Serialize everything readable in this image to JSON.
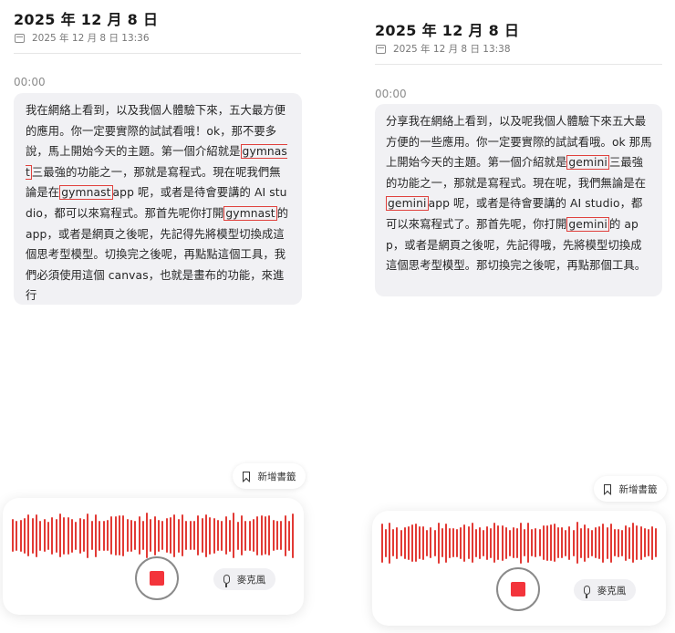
{
  "left": {
    "title": "2025 年 12 月 8 日",
    "datetime": "2025 年 12 月 8 日 13:36",
    "timestamp": "00:00",
    "segments": [
      {
        "t": "我在網絡上看到，以及我個人體驗下來，五大最方便的應用。你一定要實際的試試看哦！ok，那不要多說，馬上開始今天的主題。第一個介紹就是"
      },
      {
        "t": "gymnast",
        "hl": true
      },
      {
        "t": "三最強的功能之一，那就是寫程式。現在呢我們無論是在"
      },
      {
        "t": "gymnast",
        "hl": true
      },
      {
        "t": "app 呢，或者是待會要講的 AI studio，都可以來寫程式。那首先呢你打開"
      },
      {
        "t": "gymnast",
        "hl": true
      },
      {
        "t": "的 app，或者是網頁之後呢，先記得先將模型切換成這個思考型模型。切換完之後呢，再點點這個工具，我們必須使用這個 canvas，也就是畫布的功能，來進行"
      }
    ],
    "bookmark_label": "新增書籤",
    "mic_label": "麥克風"
  },
  "right": {
    "title": "2025 年 12 月 8 日",
    "datetime": "2025 年 12 月 8 日 13:38",
    "timestamp": "00:00",
    "segments": [
      {
        "t": "分享我在網絡上看到，以及呢我個人體驗下來五大最方便的一些應用。你一定要實際的試試看哦。ok 那馬上開始今天的主題。第一個介紹就是"
      },
      {
        "t": "gemini",
        "hl": true
      },
      {
        "t": "三最強的功能之一，那就是寫程式。現在呢，我們無論是在"
      },
      {
        "t": "gemini",
        "hl": true
      },
      {
        "t": "app 呢，或者是待會要講的 AI studio，都可以來寫程式了。那首先呢，你打開"
      },
      {
        "t": "gemini",
        "hl": true
      },
      {
        "t": "的 app，或者是網頁之後呢，先記得哦，先將模型切換成這個思考型模型。那切換完之後呢，再點那個工具。"
      }
    ],
    "bookmark_label": "新增書籤",
    "mic_label": "麥克風"
  },
  "icons": {
    "calendar": "calendar-icon",
    "bookmark": "bookmark-icon",
    "mic": "microphone-icon",
    "stop": "stop-record-icon"
  },
  "colors": {
    "waveform": "#e23a35",
    "stop_button": "#f3343b",
    "highlight_box": "#e0413d",
    "bubble_bg": "#f1f1f4"
  }
}
